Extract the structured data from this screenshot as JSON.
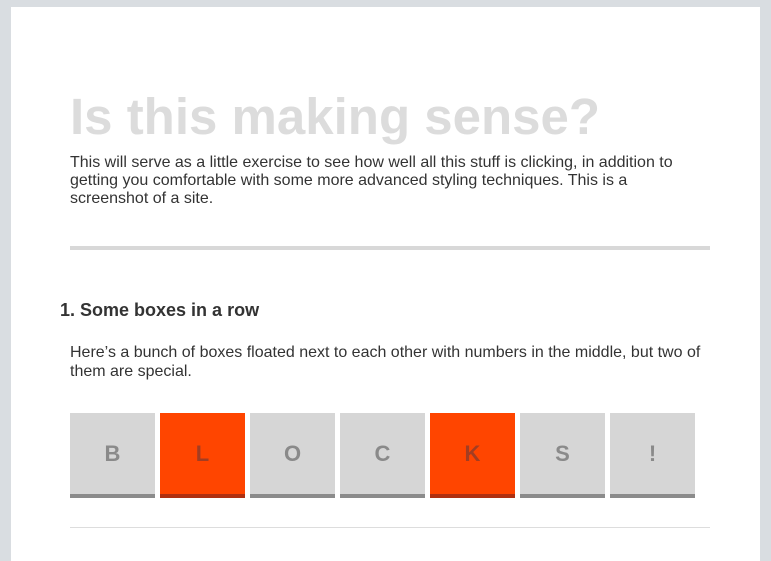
{
  "page": {
    "title": "Is this making sense?",
    "intro": "This will serve as a little exercise to see how well all this stuff is clicking, in addition to getting you comfortable with some more advanced styling techniques. This is a screenshot of a site."
  },
  "section1": {
    "heading": "1. Some boxes in a row",
    "description": "Here’s a bunch of boxes floated next to each other with numbers in the middle, but two of them are special.",
    "boxes": [
      {
        "label": "B",
        "special": false
      },
      {
        "label": "L",
        "special": true
      },
      {
        "label": "O",
        "special": false
      },
      {
        "label": "C",
        "special": false
      },
      {
        "label": "K",
        "special": true
      },
      {
        "label": "S",
        "special": false
      },
      {
        "label": "!",
        "special": false
      }
    ]
  },
  "colors": {
    "page_background": "#d9dde1",
    "box_default": "#d6d6d6",
    "box_special": "#ff4500",
    "title_color": "#dcdcdc",
    "body_text": "#333333"
  }
}
